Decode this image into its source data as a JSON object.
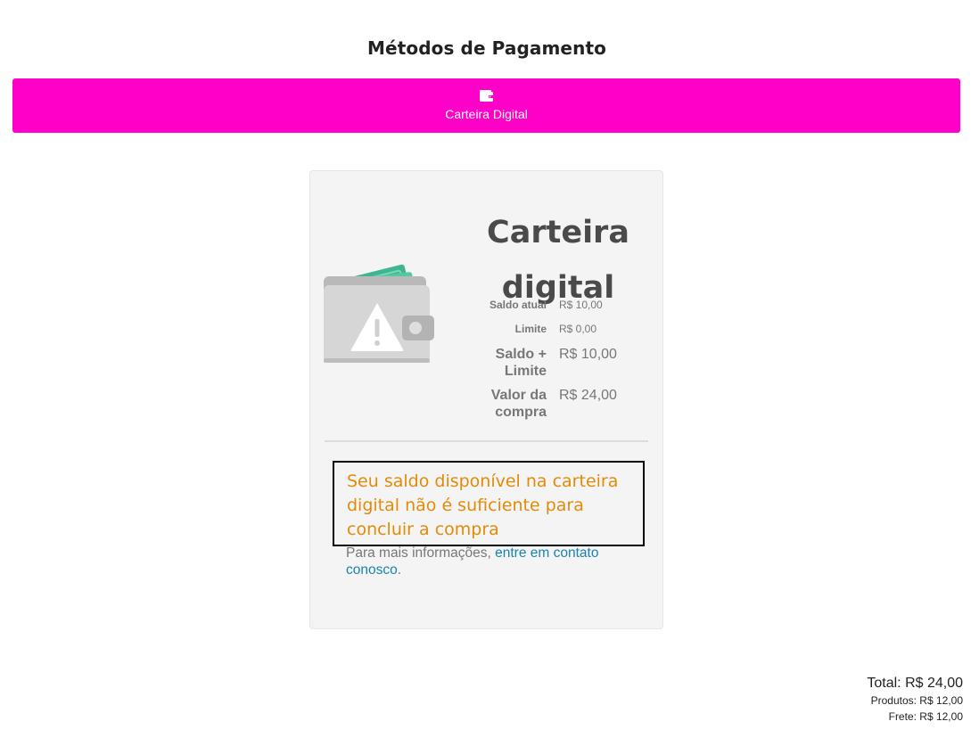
{
  "page": {
    "title": "Métodos de Pagamento"
  },
  "payment_methods": {
    "tabs": [
      {
        "label": "Carteira Digital",
        "icon": "wallet-icon",
        "active": true
      }
    ]
  },
  "colors": {
    "accent": "#ff00c8",
    "warning": "#e38b08",
    "link": "#1a84b0"
  },
  "wallet": {
    "title": "Carteira digital",
    "balances": {
      "saldo_atual": {
        "label": "Saldo atual",
        "value": "R$ 10,00"
      },
      "limite": {
        "label": "Limite",
        "value": "R$ 0,00"
      },
      "saldo_limite": {
        "label": "Saldo + Limite",
        "value": "R$ 10,00"
      },
      "valor_compra": {
        "label": "Valor da compra",
        "value": "R$ 24,00"
      }
    },
    "warning": "Seu saldo disponível na carteira digital não é suficiente para concluir a compra",
    "info_prefix": "Para mais informações, ",
    "info_link": "entre em contato conosco",
    "info_suffix": "."
  },
  "totals": {
    "total": "Total: R$ 24,00",
    "produtos": "Produtos: R$ 12,00",
    "frete": "Frete: R$ 12,00"
  }
}
